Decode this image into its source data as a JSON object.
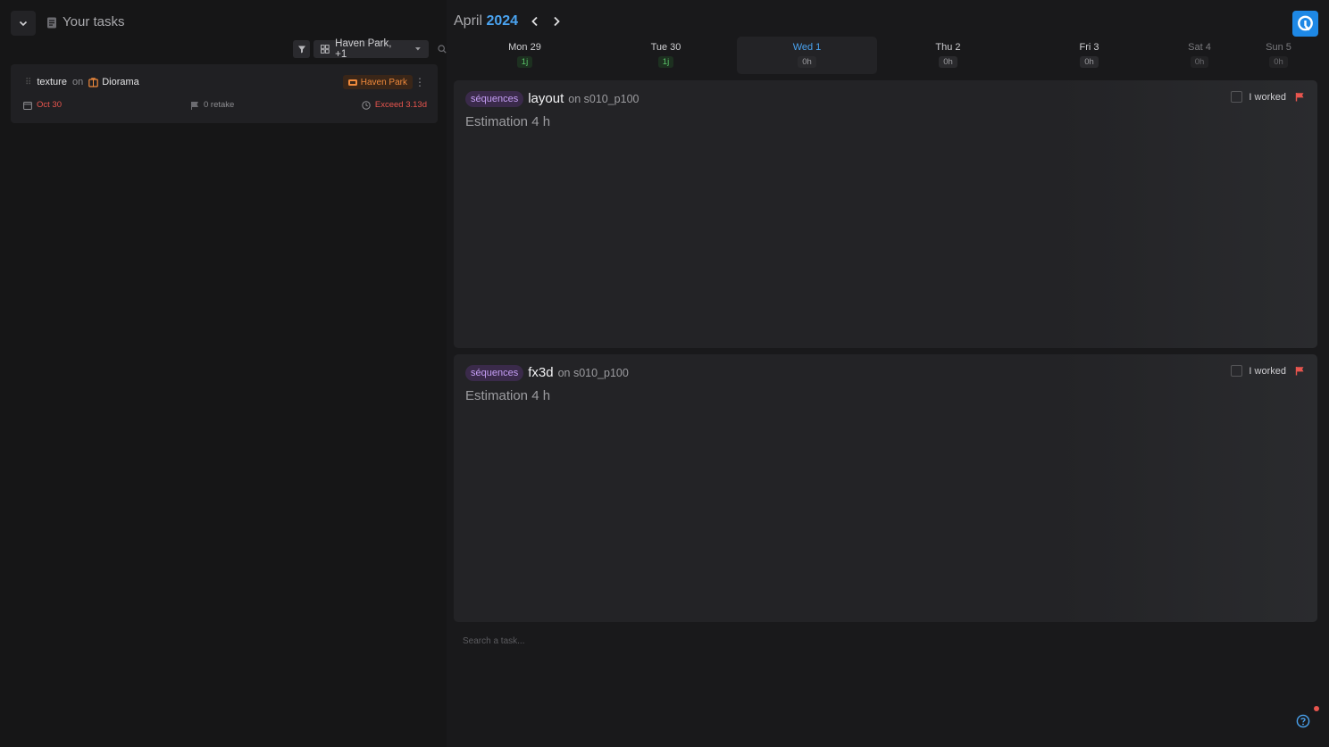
{
  "sidebar": {
    "title": "Your tasks",
    "filter": {
      "project_label": "Haven Park, +1"
    },
    "tasks": [
      {
        "task_type": "texture",
        "on": "on",
        "entity": "Diorama",
        "production": "Haven Park",
        "due_date": "Oct 30",
        "retakes": "0 retake",
        "exceed": "Exceed 3.13d"
      }
    ]
  },
  "calendar": {
    "month": "April",
    "year": "2024",
    "days": [
      {
        "label": "Mon 29",
        "hours": "1j"
      },
      {
        "label": "Tue 30",
        "hours": "1j"
      },
      {
        "label": "Wed 1",
        "hours": "0h"
      },
      {
        "label": "Thu 2",
        "hours": "0h"
      },
      {
        "label": "Fri 3",
        "hours": "0h"
      },
      {
        "label": "Sat 4",
        "hours": "0h"
      },
      {
        "label": "Sun 5",
        "hours": "0h"
      }
    ]
  },
  "day_tasks": [
    {
      "type": "séquences",
      "name": "layout",
      "on": "on s010_p100",
      "estimation": "Estimation 4 h",
      "worked_label": "I worked"
    },
    {
      "type": "séquences",
      "name": "fx3d",
      "on": "on s010_p100",
      "estimation": "Estimation 4 h",
      "worked_label": "I worked"
    }
  ],
  "search": {
    "placeholder": "Search a task..."
  },
  "colors": {
    "accent": "#4aa3f0",
    "error": "#e8554e",
    "production": "#f08a3c",
    "chip": "#c59ef5"
  }
}
